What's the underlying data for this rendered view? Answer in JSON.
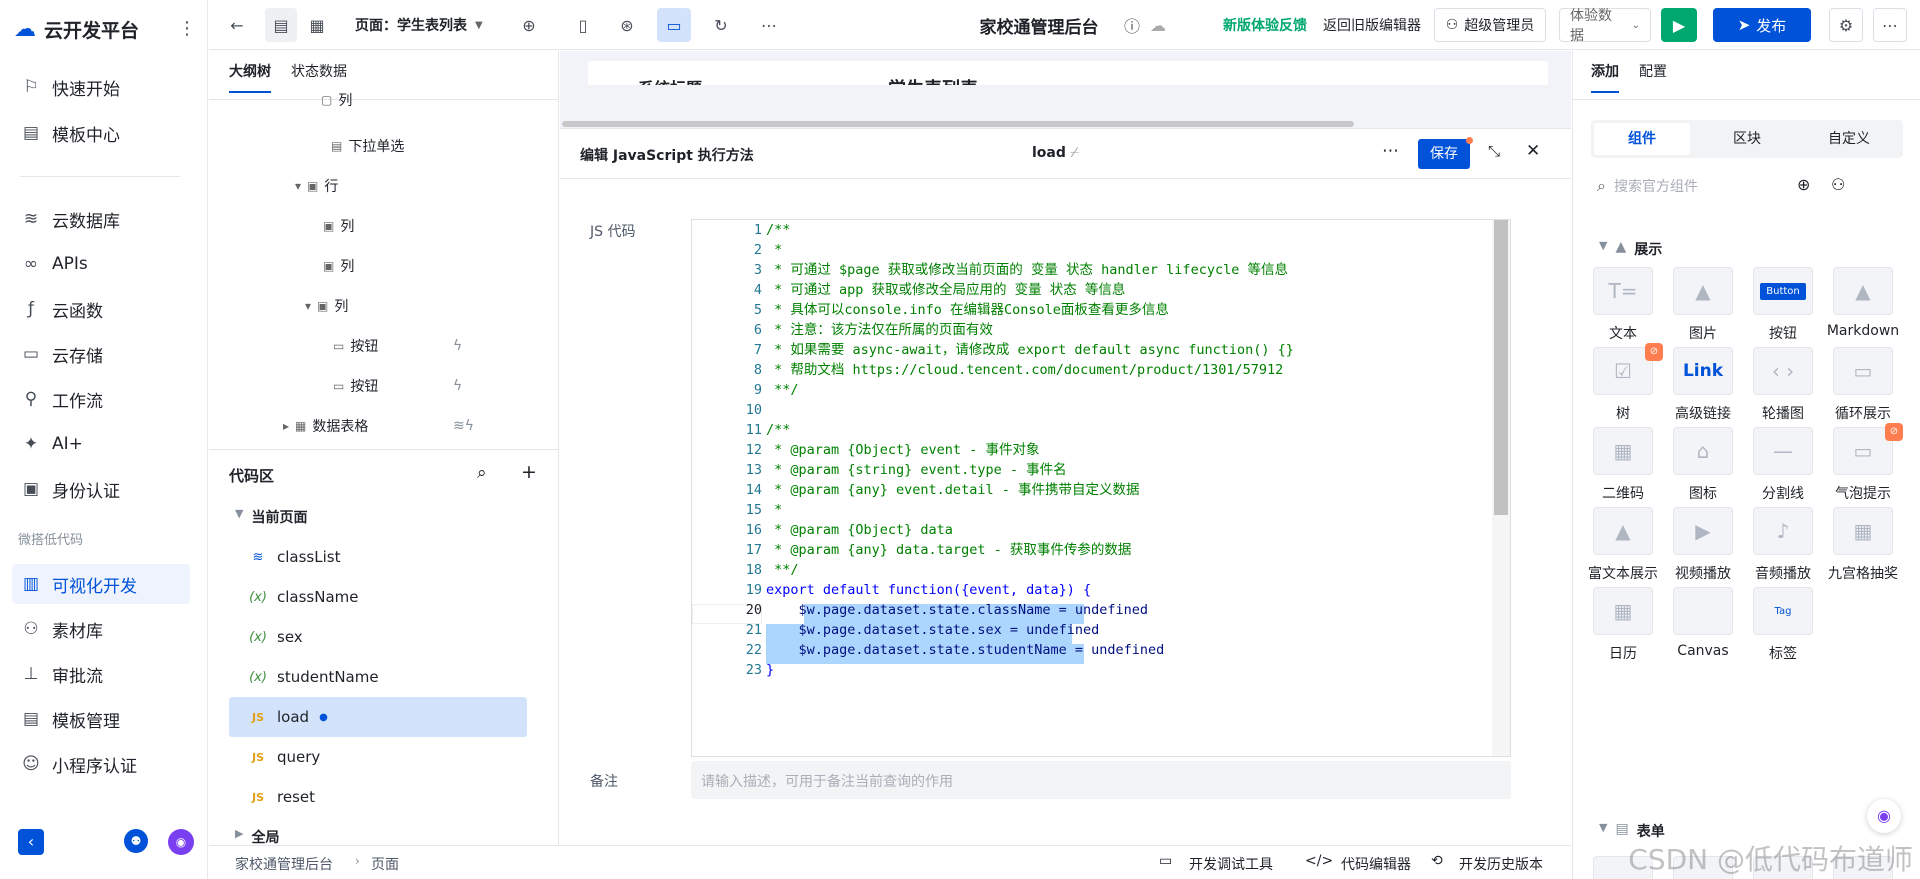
{
  "app": {
    "title": "云开发平台",
    "nav_items": [
      {
        "label": "快速开始"
      },
      {
        "label": "模板中心"
      },
      {
        "label": "云数据库"
      },
      {
        "label": "APIs"
      },
      {
        "label": "云函数"
      },
      {
        "label": "云存储"
      },
      {
        "label": "工作流"
      },
      {
        "label": "AI+"
      },
      {
        "label": "身份认证"
      },
      {
        "label": "可视化开发"
      },
      {
        "label": "素材库"
      },
      {
        "label": "审批流"
      },
      {
        "label": "模板管理"
      },
      {
        "label": "小程序认证"
      }
    ],
    "nav_group": "微搭低代码",
    "active_nav": "可视化开发"
  },
  "toolbar": {
    "page_select": "页面：学生表列表",
    "app_title": "家校通管理后台",
    "feedback": "新版体验反馈",
    "back_old": "返回旧版编辑器",
    "user": "超级管理员",
    "data_select": "体验数据",
    "publish": "发布"
  },
  "outline": {
    "tabs": [
      "大纲树",
      "状态数据"
    ],
    "tree": [
      {
        "label": "列"
      },
      {
        "label": "下拉单选"
      },
      {
        "label": "行"
      },
      {
        "label": "列"
      },
      {
        "label": "列"
      },
      {
        "label": "列"
      },
      {
        "label": "按钮"
      },
      {
        "label": "按钮"
      },
      {
        "label": "数据表格"
      }
    ],
    "code_area_title": "代码区",
    "current_page": "当前页面",
    "code_items": [
      {
        "label": "classList",
        "kind": "query"
      },
      {
        "label": "className",
        "kind": "var"
      },
      {
        "label": "sex",
        "kind": "var"
      },
      {
        "label": "studentName",
        "kind": "var"
      },
      {
        "label": "load",
        "kind": "js"
      },
      {
        "label": "query",
        "kind": "js"
      },
      {
        "label": "reset",
        "kind": "js"
      }
    ],
    "global": "全局"
  },
  "canvas": {
    "partial_left": "系统标题",
    "partial_right": "学生表列表"
  },
  "editor": {
    "title": "编辑 JavaScript 执行方法",
    "method_name": "load",
    "save": "保存",
    "js_code_label": "JS 代码",
    "remark_label": "备注",
    "remark_placeholder": "请输入描述，可用于备注当前查询的作用",
    "lines": [
      {
        "n": "1",
        "t": "/**"
      },
      {
        "n": "2",
        "t": " *"
      },
      {
        "n": "3",
        "t": " * 可通过 $page 获取或修改当前页面的 变量 状态 handler lifecycle 等信息"
      },
      {
        "n": "4",
        "t": " * 可通过 app 获取或修改全局应用的 变量 状态 等信息"
      },
      {
        "n": "5",
        "t": " * 具体可以console.info 在编辑器Console面板查看更多信息"
      },
      {
        "n": "6",
        "t": " * 注意：该方法仅在所属的页面有效"
      },
      {
        "n": "7",
        "t": " * 如果需要 async-await，请修改成 export default async function() {}"
      },
      {
        "n": "8",
        "t": " * 帮助文档 https://cloud.tencent.com/document/product/1301/57912"
      },
      {
        "n": "9",
        "t": " **/"
      },
      {
        "n": "10",
        "t": ""
      },
      {
        "n": "11",
        "t": "/**"
      },
      {
        "n": "12",
        "t": " * @param {Object} event - 事件对象"
      },
      {
        "n": "13",
        "t": " * @param {string} event.type - 事件名"
      },
      {
        "n": "14",
        "t": " * @param {any} event.detail - 事件携带自定义数据"
      },
      {
        "n": "15",
        "t": " *"
      },
      {
        "n": "16",
        "t": " * @param {Object} data"
      },
      {
        "n": "17",
        "t": " * @param {any} data.target - 获取事件传参的数据"
      },
      {
        "n": "18",
        "t": " **/"
      },
      {
        "n": "19",
        "t": "export default function({event, data}) {"
      },
      {
        "n": "20",
        "t": "    $w.page.dataset.state.className = undefined"
      },
      {
        "n": "21",
        "t": "    $w.page.dataset.state.sex = undefined"
      },
      {
        "n": "22",
        "t": "    $w.page.dataset.state.studentName = undefined"
      },
      {
        "n": "23",
        "t": "}"
      }
    ]
  },
  "footer": {
    "breadcrumb": [
      "家校通管理后台",
      "页面"
    ],
    "dev_tools": "开发调试工具",
    "code_editor": "代码编辑器",
    "history": "开发历史版本"
  },
  "right_panel": {
    "tabs": [
      "添加",
      "配置"
    ],
    "seg_tabs": [
      "组件",
      "区块",
      "自定义"
    ],
    "search_placeholder": "搜索官方组件",
    "section_display": "展示",
    "section_form": "表单",
    "components": [
      {
        "label": "文本",
        "thumb": "T="
      },
      {
        "label": "图片",
        "thumb": "▲"
      },
      {
        "label": "按钮",
        "thumb": "Button"
      },
      {
        "label": "Markdown",
        "thumb": "▲"
      },
      {
        "label": "树",
        "thumb": "☑"
      },
      {
        "label": "高级链接",
        "thumb": "Link"
      },
      {
        "label": "轮播图",
        "thumb": "‹ ›"
      },
      {
        "label": "循环展示",
        "thumb": "▭"
      },
      {
        "label": "二维码",
        "thumb": "▦"
      },
      {
        "label": "图标",
        "thumb": "⌂"
      },
      {
        "label": "分割线",
        "thumb": "—"
      },
      {
        "label": "气泡提示",
        "thumb": "▭"
      },
      {
        "label": "富文本展示",
        "thumb": "▲"
      },
      {
        "label": "视频播放",
        "thumb": "▶"
      },
      {
        "label": "音频播放",
        "thumb": "♪"
      },
      {
        "label": "九宫格抽奖",
        "thumb": "▦"
      },
      {
        "label": "日历",
        "thumb": "▦"
      },
      {
        "label": "Canvas",
        "thumb": ""
      },
      {
        "label": "标签",
        "thumb": "Tag"
      }
    ]
  },
  "watermark": "CSDN @低代码布道师"
}
